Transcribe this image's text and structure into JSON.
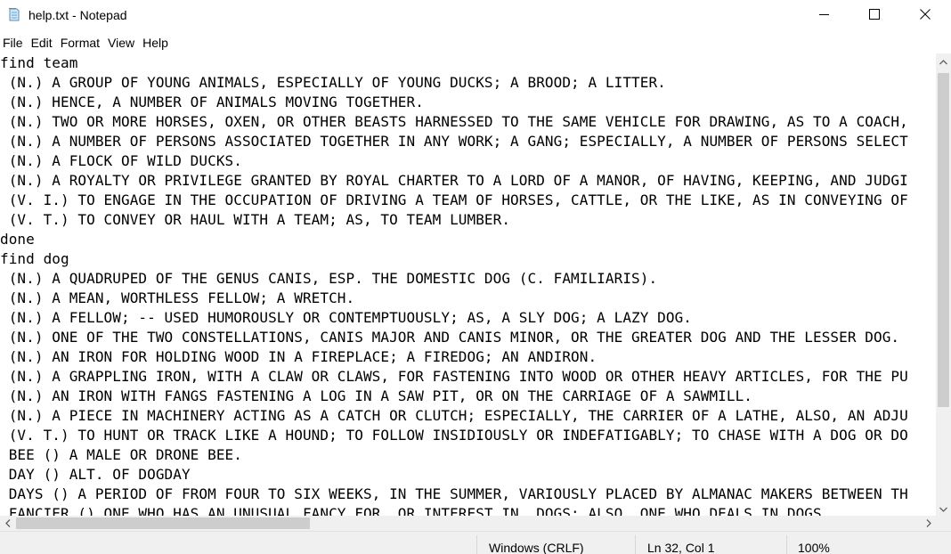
{
  "window": {
    "title": "help.txt - Notepad",
    "icon": "notepad-icon",
    "controls": [
      "minimize-icon",
      "maximize-icon",
      "close-icon"
    ]
  },
  "menu": {
    "file": "File",
    "edit": "Edit",
    "format": "Format",
    "view": "View",
    "help": "Help"
  },
  "editor": {
    "lines": [
      "find team",
      " (N.) A GROUP OF YOUNG ANIMALS, ESPECIALLY OF YOUNG DUCKS; A BROOD; A LITTER.",
      " (N.) HENCE, A NUMBER OF ANIMALS MOVING TOGETHER.",
      " (N.) TWO OR MORE HORSES, OXEN, OR OTHER BEASTS HARNESSED TO THE SAME VEHICLE FOR DRAWING, AS TO A COACH,",
      " (N.) A NUMBER OF PERSONS ASSOCIATED TOGETHER IN ANY WORK; A GANG; ESPECIALLY, A NUMBER OF PERSONS SELECT",
      " (N.) A FLOCK OF WILD DUCKS.",
      " (N.) A ROYALTY OR PRIVILEGE GRANTED BY ROYAL CHARTER TO A LORD OF A MANOR, OF HAVING, KEEPING, AND JUDGI",
      " (V. I.) TO ENGAGE IN THE OCCUPATION OF DRIVING A TEAM OF HORSES, CATTLE, OR THE LIKE, AS IN CONVEYING OF",
      " (V. T.) TO CONVEY OR HAUL WITH A TEAM; AS, TO TEAM LUMBER.",
      "done",
      "find dog",
      " (N.) A QUADRUPED OF THE GENUS CANIS, ESP. THE DOMESTIC DOG (C. FAMILIARIS).",
      " (N.) A MEAN, WORTHLESS FELLOW; A WRETCH.",
      " (N.) A FELLOW; -- USED HUMOROUSLY OR CONTEMPTUOUSLY; AS, A SLY DOG; A LAZY DOG.",
      " (N.) ONE OF THE TWO CONSTELLATIONS, CANIS MAJOR AND CANIS MINOR, OR THE GREATER DOG AND THE LESSER DOG.",
      " (N.) AN IRON FOR HOLDING WOOD IN A FIREPLACE; A FIREDOG; AN ANDIRON.",
      " (N.) A GRAPPLING IRON, WITH A CLAW OR CLAWS, FOR FASTENING INTO WOOD OR OTHER HEAVY ARTICLES, FOR THE PU",
      " (N.) AN IRON WITH FANGS FASTENING A LOG IN A SAW PIT, OR ON THE CARRIAGE OF A SAWMILL.",
      " (N.) A PIECE IN MACHINERY ACTING AS A CATCH OR CLUTCH; ESPECIALLY, THE CARRIER OF A LATHE, ALSO, AN ADJU",
      " (V. T.) TO HUNT OR TRACK LIKE A HOUND; TO FOLLOW INSIDIOUSLY OR INDEFATIGABLY; TO CHASE WITH A DOG OR DO",
      " BEE () A MALE OR DRONE BEE.",
      " DAY () ALT. OF DOGDAY",
      " DAYS () A PERIOD OF FROM FOUR TO SIX WEEKS, IN THE SUMMER, VARIOUSLY PLACED BY ALMANAC MAKERS BETWEEN TH",
      " FANCIER () ONE WHO HAS AN UNUSUAL FANCY FOR, OR INTEREST IN, DOGS; ALSO, ONE WHO DEALS IN DOGS."
    ]
  },
  "scrollbars": {
    "vertical": {
      "position": 0.0,
      "visible_fraction": 0.8
    },
    "horizontal": {
      "position": 0.0,
      "visible_fraction": 0.33
    }
  },
  "status": {
    "line_ending": "Windows (CRLF)",
    "cursor": "Ln 32, Col 1",
    "zoom": "100%"
  },
  "colors": {
    "background": "#ffffff",
    "chrome": "#f0f0f0",
    "scroll_thumb": "#cdcdcd",
    "text": "#000000"
  }
}
